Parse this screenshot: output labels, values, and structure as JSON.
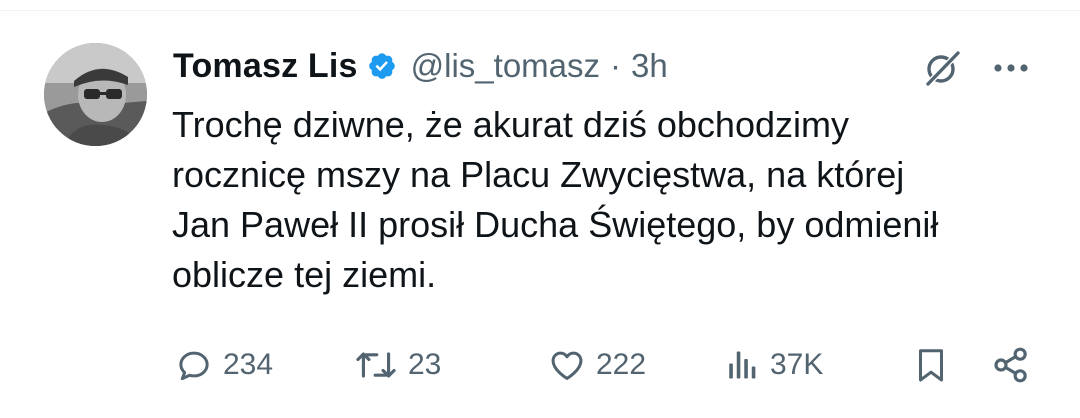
{
  "tweet": {
    "author": {
      "display_name": "Tomasz Lis",
      "handle": "@lis_tomasz",
      "verified": true,
      "verified_icon": "verified-badge-icon"
    },
    "separator": "·",
    "time": "3h",
    "text_lines": [
      "Trochę dziwne, że akurat dziś obchodzimy",
      "rocznicę mszy na Placu Zwycięstwa, na której",
      "Jan Paweł II prosił Ducha Świętego, by odmienił",
      "oblicze tej ziemi."
    ],
    "actions": {
      "replies": "234",
      "reposts": "23",
      "likes": "222",
      "views": "37K"
    }
  },
  "colors": {
    "text": "#0f1419",
    "secondary": "#536471",
    "verified": "#1d9bf0",
    "divider": "#eff3f4"
  }
}
